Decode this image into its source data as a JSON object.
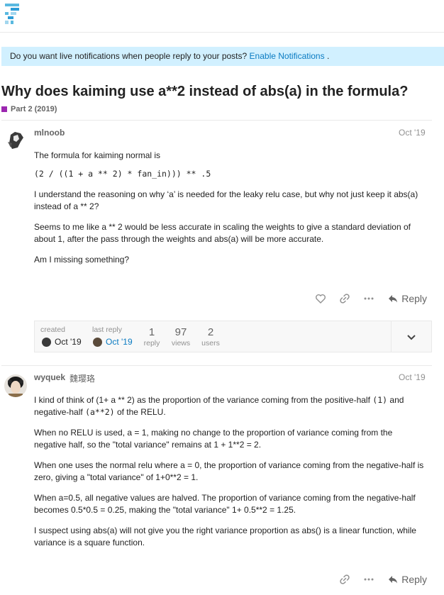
{
  "notification": {
    "text": "Do you want live notifications when people reply to your posts?",
    "link": "Enable Notifications",
    "end": "."
  },
  "topic": {
    "title": "Why does kaiming use a**2 instead of abs(a) in the formula?",
    "category": "Part 2 (2019)",
    "category_color": "#9c27b0"
  },
  "posts": [
    {
      "username": "mlnoob",
      "date": "Oct '19",
      "p1": "The formula for kaiming normal is",
      "code": "(2 / ((1 + a ** 2) * fan_in))) ** .5",
      "p2": "I understand the reasoning on why ‘a’ is needed for the leaky relu case, but why not just keep it abs(a) instead of a ** 2?",
      "p3": "Seems to me like a ** 2 would be less accurate in scaling the weights to give a standard deviation of about 1, after the pass through the weights and abs(a) will be more accurate.",
      "p4": "Am I missing something?",
      "reply_label": "Reply"
    },
    {
      "username": "wyquek",
      "fullname": "魏璎珞",
      "date": "Oct '19",
      "p1a": "I kind of think of (1+ a ** 2) as the proportion of the variance coming from the positive-half",
      "p1code1": "(1)",
      "p1b": "and negative-half",
      "p1code2": "(a**2)",
      "p1c": "of the RELU.",
      "p2": "When no RELU is used, a = 1, making no change to the proportion of variance coming from the negative half, so the \"total variance\" remains at 1 + 1**2 = 2.",
      "p3": "When one uses the normal relu where a = 0, the proportion of variance coming from the negative-half is zero, giving a \"total variance\" of 1+0**2 = 1.",
      "p4": "When a=0.5, all negative values are halved. The proportion of variance coming from the negative-half becomes 0.5*0.5 = 0.25, making the \"total variance\" 1+ 0.5**2 = 1.25.",
      "p5": "I suspect using abs(a) will not give you the right variance proportion as abs() is a linear function, while variance is a square function.",
      "reply_label": "Reply"
    }
  ],
  "topic_map": {
    "created_label": "created",
    "created_date": "Oct '19",
    "last_reply_label": "last reply",
    "last_reply_date": "Oct '19",
    "replies_count": "1",
    "replies_label": "reply",
    "views_count": "97",
    "views_label": "views",
    "users_count": "2",
    "users_label": "users"
  },
  "icons": [
    "logo-icon",
    "heart-icon",
    "link-icon",
    "more-icon",
    "reply-icon",
    "chevron-down-icon"
  ],
  "colors": {
    "link": "#0a7bc2",
    "notice_bg": "#d1f0ff",
    "muted": "#919191"
  }
}
